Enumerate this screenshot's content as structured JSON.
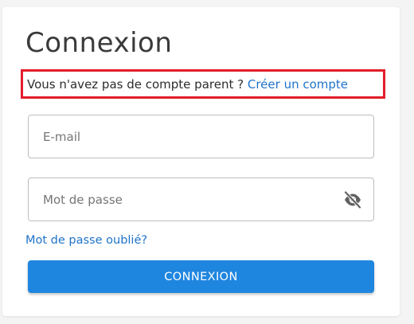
{
  "login": {
    "title": "Connexion",
    "signup_prompt": "Vous n'avez pas de compte parent ? ",
    "signup_link": "Créer un compte",
    "email_placeholder": "E-mail",
    "password_placeholder": "Mot de passe",
    "password_toggle_icon": "eye-slash-icon",
    "forgot_password": "Mot de passe oublié?",
    "submit_label": "CONNEXION"
  },
  "colors": {
    "link": "#1f73c9",
    "button": "#1f86e0",
    "highlight_box": "#e11d2a"
  }
}
